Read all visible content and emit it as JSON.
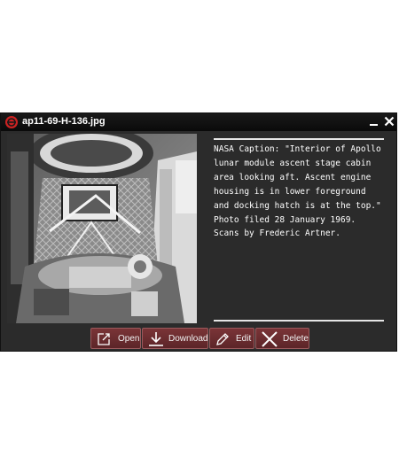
{
  "window": {
    "title": "ap11-69-H-136.jpg",
    "app_icon": "red-circle-logo-icon",
    "minimize_icon": "minimize-icon",
    "close_icon": "close-icon"
  },
  "photo": {
    "alt": "Interior of Apollo lunar module ascent stage cabin, black and white photograph"
  },
  "caption": {
    "text": "NASA Caption: \"Interior of Apollo lunar module ascent stage cabin area looking aft. Ascent engine housing is in lower foreground and docking hatch is at the top.\" Photo filed 28 January 1969. Scans by Frederic Artner."
  },
  "toolbar": {
    "open_label": "Open",
    "open_icon": "open-external-icon",
    "download_label": "Download",
    "download_icon": "download-icon",
    "edit_label": "Edit",
    "edit_icon": "pencil-icon",
    "delete_label": "Delete",
    "delete_icon": "x-icon"
  },
  "colors": {
    "window_bg": "#2b2b2b",
    "titlebar_bg": "#0a0a0a",
    "button_bg": "#6b2e31",
    "accent_red": "#cc2222",
    "text": "#ffffff"
  }
}
